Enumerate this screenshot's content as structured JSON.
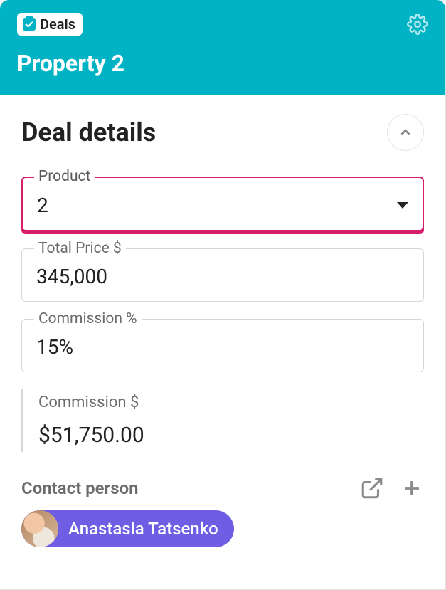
{
  "header": {
    "chip_label": "Deals",
    "title": "Property 2"
  },
  "section": {
    "title": "Deal details"
  },
  "fields": {
    "product": {
      "label": "Product",
      "value": "2"
    },
    "total_price": {
      "label": "Total Price $",
      "value": "345,000"
    },
    "commission_pct": {
      "label": "Commission %",
      "value": "15%"
    },
    "commission_amt": {
      "label": "Commission $",
      "value": "$51,750.00"
    }
  },
  "contact": {
    "label": "Contact person",
    "person_name": "Anastasia Tatsenko"
  }
}
